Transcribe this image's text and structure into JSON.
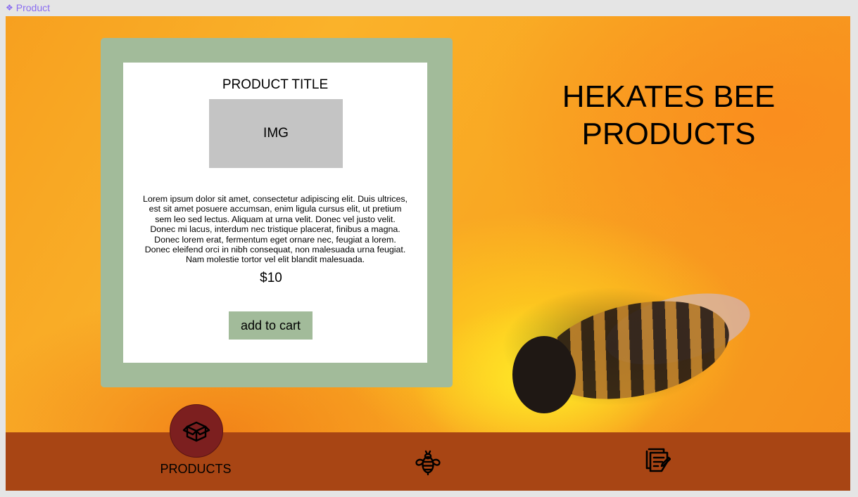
{
  "frame": {
    "label": "Product"
  },
  "card": {
    "title": "PRODUCT TITLE",
    "image_placeholder": "IMG",
    "description": "Lorem ipsum dolor sit amet, consectetur adipiscing elit. Duis ultrices, est sit amet posuere accumsan, enim ligula cursus elit, ut pretium sem leo sed lectus. Aliquam at urna velit. Donec vel justo velit. Donec mi lacus, interdum nec tristique placerat, finibus a magna. Donec lorem erat, fermentum eget ornare nec, feugiat a lorem. Donec eleifend orci in nibh consequat, non malesuada urna feugiat. Nam molestie tortor vel elit blandit malesuada.",
    "price": "$10",
    "add_to_cart_label": "add to cart"
  },
  "brand": {
    "line1": "HEKATES BEE",
    "line2": "PRODUCTS"
  },
  "nav": {
    "items": [
      {
        "label": "PRODUCTS",
        "icon": "box-icon",
        "active": true
      },
      {
        "label": "",
        "icon": "bee-icon",
        "active": false
      },
      {
        "label": "",
        "icon": "notes-icon",
        "active": false
      }
    ]
  },
  "colors": {
    "card_frame": "#a2bb9a",
    "nav_bar": "#a84514",
    "active_nav_circle": "#7c1f1f",
    "frame_label": "#8a6df0"
  }
}
